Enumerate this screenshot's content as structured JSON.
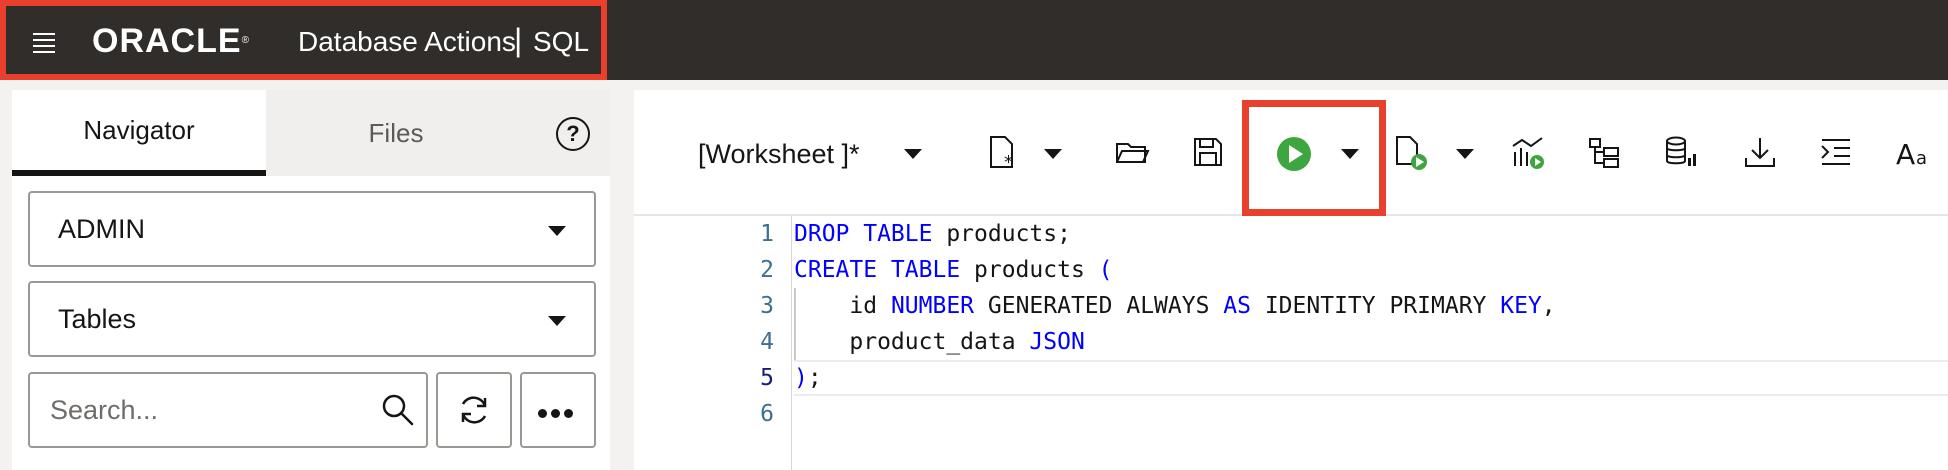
{
  "header": {
    "brand": "ORACLE",
    "brand_mark": "®",
    "app_name": "Database Actions",
    "separator": "|",
    "section": "SQL"
  },
  "left_panel": {
    "tabs": [
      {
        "label": "Navigator",
        "active": true
      },
      {
        "label": "Files",
        "active": false
      }
    ],
    "help_label": "?",
    "schema_select": "ADMIN",
    "object_type_select": "Tables",
    "search": {
      "placeholder": "Search...",
      "value": ""
    }
  },
  "toolbar": {
    "worksheet_label": "[Worksheet ]*",
    "icons": [
      "new-worksheet-icon",
      "open-icon",
      "save-icon",
      "run-statement-icon",
      "run-script-icon",
      "explain-plan-icon",
      "autotrace-icon",
      "sql-history-icon",
      "download-icon",
      "format-icon",
      "font-size-icon"
    ],
    "highlight_color": "#e8402c",
    "run_color": "#3ea63e"
  },
  "editor": {
    "line_numbers": [
      "1",
      "2",
      "3",
      "4",
      "5",
      "6"
    ],
    "lines": [
      [
        {
          "t": "DROP TABLE",
          "k": true
        },
        {
          "t": " products;",
          "k": false
        }
      ],
      [
        {
          "t": "CREATE TABLE",
          "k": true
        },
        {
          "t": " products ",
          "k": false
        },
        {
          "t": "(",
          "k": true
        }
      ],
      [
        {
          "t": "    id ",
          "k": false
        },
        {
          "t": "NUMBER",
          "k": true
        },
        {
          "t": " GENERATED ALWAYS ",
          "k": false
        },
        {
          "t": "AS",
          "k": true
        },
        {
          "t": " IDENTITY PRIMARY ",
          "k": false
        },
        {
          "t": "KEY",
          "k": true
        },
        {
          "t": ",",
          "k": false
        }
      ],
      [
        {
          "t": "    product_data ",
          "k": false
        },
        {
          "t": "JSON",
          "k": true
        }
      ],
      [
        {
          "t": ")",
          "k": true
        },
        {
          "t": ";",
          "k": false
        }
      ],
      []
    ],
    "keyword_color": "#0000ff",
    "current_line": "5"
  }
}
